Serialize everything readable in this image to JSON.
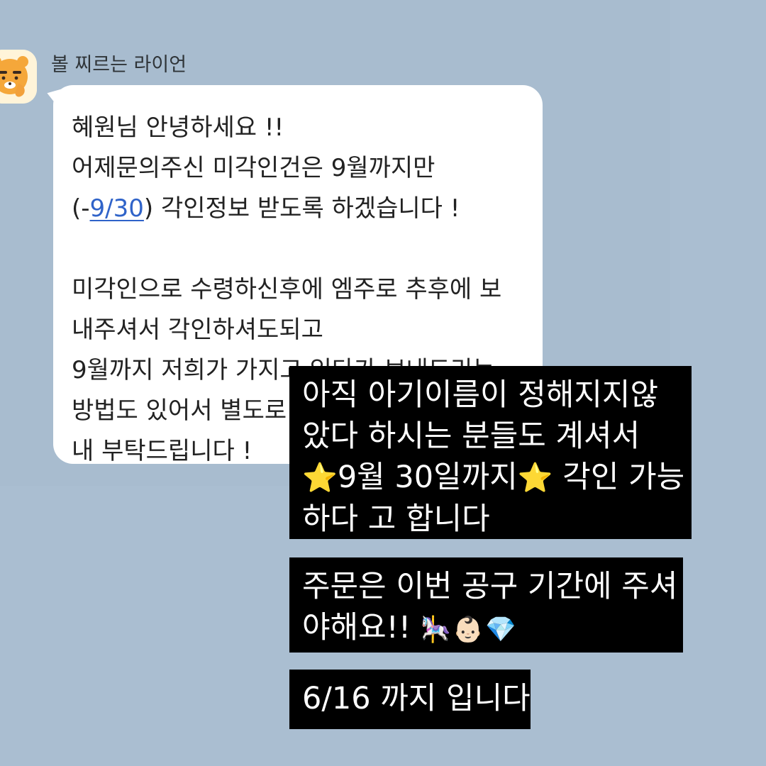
{
  "chat": {
    "sender_name": "볼 찌르는 라이언",
    "message": {
      "line1": "혜원님 안녕하세요 !!",
      "line2": "어제문의주신 미각인건은 9월까지만",
      "line3_prefix": "(-",
      "line3_link": "9/30",
      "line3_suffix": ") 각인정보 받도록 하겠습니다 !",
      "line4": "미각인으로 수령하신후에 엠주로 추후에 보",
      "line5": "내주셔서 각인하셔도되고",
      "line6": "9월까지 저희가 가지고 있다가 보내드리는",
      "line7": "방법도 있어서 별도로",
      "line8": "내 부탁드립니다 !"
    },
    "link_color": "#2f63c9"
  },
  "overlays": {
    "box1": {
      "line1": "아직 아기이름이 정해지지않",
      "line2": "았다 하시는 분들도 계셔서",
      "line3_text1": "9월 30일까지",
      "line3_text2": " 각인 가능",
      "line4": "하다 고 합니다",
      "star": "⭐"
    },
    "box2": {
      "line1": "주문은 이번 공구 기간에 주셔",
      "line2_text": "야해요!! ",
      "emojis": "🎠👶🏻💎"
    },
    "box3": {
      "line1": "6/16 까지 입니다"
    }
  },
  "colors": {
    "background": "#aabed1",
    "bubble": "#ffffff",
    "overlay": "#000000",
    "overlay_text": "#ffffff"
  },
  "icons": {
    "avatar": "ryan-avatar-icon",
    "star": "star-emoji-icon",
    "carousel": "carousel-horse-emoji-icon",
    "baby": "baby-face-emoji-icon",
    "diamond": "diamond-emoji-icon"
  }
}
